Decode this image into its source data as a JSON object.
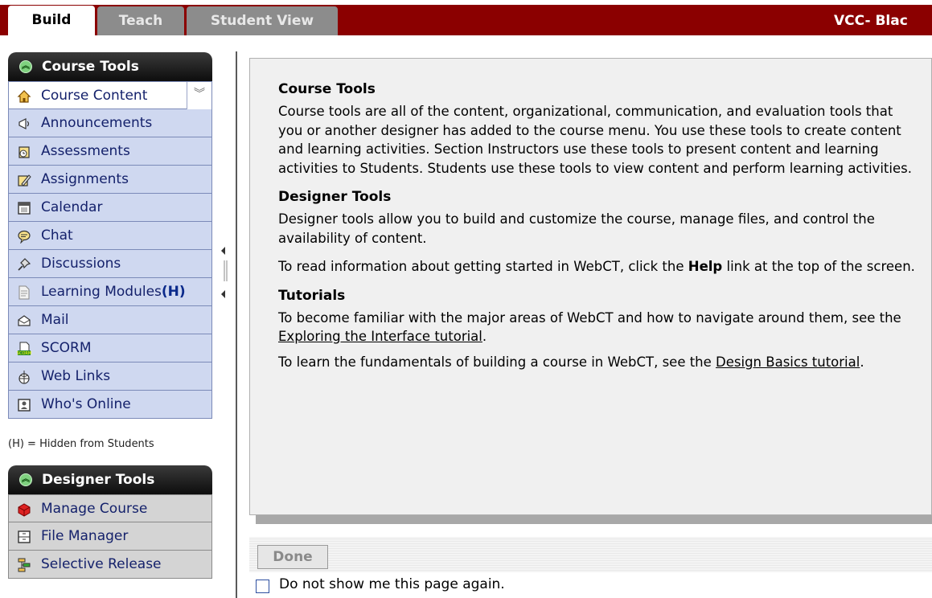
{
  "tabs": [
    {
      "label": "Build",
      "active": true
    },
    {
      "label": "Teach",
      "active": false
    },
    {
      "label": "Student View",
      "active": false
    }
  ],
  "institution": "VCC- Blac",
  "course_tools": {
    "header": "Course Tools",
    "items": [
      {
        "label": "Course Content",
        "icon": "home-icon",
        "selected": true
      },
      {
        "label": "Announcements",
        "icon": "megaphone-icon"
      },
      {
        "label": "Assessments",
        "icon": "clipboard-clock-icon"
      },
      {
        "label": "Assignments",
        "icon": "pencil-paper-icon"
      },
      {
        "label": "Calendar",
        "icon": "calendar-icon"
      },
      {
        "label": "Chat",
        "icon": "chat-bubble-icon"
      },
      {
        "label": "Discussions",
        "icon": "pushpin-icon"
      },
      {
        "label": "Learning Modules",
        "hidden_flag": "(H)",
        "icon": "document-icon"
      },
      {
        "label": "Mail",
        "icon": "envelope-icon"
      },
      {
        "label": "SCORM",
        "icon": "scorm-icon"
      },
      {
        "label": "Web Links",
        "icon": "globe-link-icon"
      },
      {
        "label": "Who's Online",
        "icon": "person-frame-icon"
      }
    ],
    "hidden_note": "(H) = Hidden from Students"
  },
  "designer_tools": {
    "header": "Designer Tools",
    "items": [
      {
        "label": "Manage Course",
        "icon": "red-cube-icon"
      },
      {
        "label": "File Manager",
        "icon": "file-cabinet-icon"
      },
      {
        "label": "Selective Release",
        "icon": "flowchart-icon"
      }
    ]
  },
  "content": {
    "course_tools_heading": "Course Tools",
    "course_tools_text": "Course tools are all of the content, organizational, communication, and evaluation tools that you or another designer has added to the course menu. You use these tools to create content and learning activities. Section Instructors use these tools to present content and learning activities to Students. Students use these tools to view content and perform learning activities.",
    "designer_tools_heading": "Designer Tools",
    "designer_tools_text": "Designer tools allow you to build and customize the course, manage files, and control the availability of content.",
    "help_text_before": "To read information about getting started in WebCT, click the ",
    "help_word": "Help",
    "help_text_after": " link at the top of the screen.",
    "tutorials_heading": "Tutorials",
    "tutorial1_before": "To become familiar with the major areas of WebCT and how to navigate around them, see the ",
    "tutorial1_link": "Exploring the Interface tutorial",
    "tutorial1_after": ".",
    "tutorial2_before": "To learn the fundamentals of building a course in WebCT, see the ",
    "tutorial2_link": "Design Basics tutorial",
    "tutorial2_after": "."
  },
  "footer": {
    "done_label": "Done",
    "checkbox_label": "Do not show me this page again."
  },
  "colors": {
    "topbar": "#8b0000",
    "menu_bg": "#cfd8f0",
    "menu_text": "#14216b"
  }
}
